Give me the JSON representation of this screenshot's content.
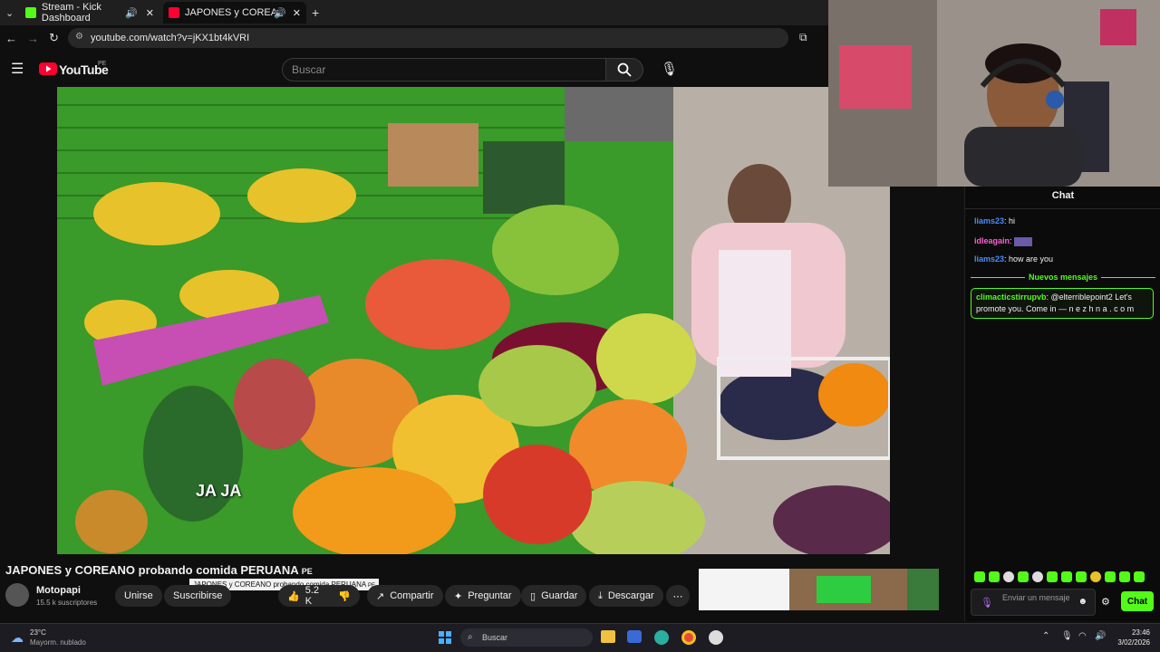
{
  "browser": {
    "tabs": [
      {
        "label": "Stream - Kick Dashboard"
      },
      {
        "label": "JAPONES y COREANO prob"
      }
    ],
    "url": "youtube.com/watch?v=jKX1bt4kVRI"
  },
  "youtube": {
    "logo_text": "YouTube",
    "region": "PE",
    "search_placeholder": "Buscar"
  },
  "video": {
    "caption": "JA JA",
    "title": "JAPONES y COREANO probando comida PERUANA",
    "title_flag": "PE",
    "tooltip": "JAPONES y COREANO probando comida PERUANA",
    "tooltip_flag": "PE"
  },
  "channel": {
    "name": "Motopapi",
    "subscribers": "15.5 k suscriptores",
    "join_label": "Unirse",
    "subscribe_label": "Suscribirse"
  },
  "actions": {
    "likes": "5.2 K",
    "share": "Compartir",
    "ask": "Preguntar",
    "save": "Guardar",
    "download": "Descargar"
  },
  "chat": {
    "header": "Chat",
    "messages": [
      {
        "user": "liams23",
        "text": ": hi"
      },
      {
        "user": "idleagain",
        "text": ":"
      },
      {
        "user": "liams23",
        "text": ": how are you"
      }
    ],
    "divider": "Nuevos mensajes",
    "highlight": {
      "user": "climacticstirrupvb",
      "text": ": @elterriblepoint2 Let's promote you. Come in — n e z h n a . c o m"
    },
    "input_placeholder": "Enviar un mensaje",
    "send_label": "Chat"
  },
  "taskbar": {
    "temp": "23°C",
    "weather": "Mayorm. nublado",
    "search_label": "Buscar",
    "time": "23:46",
    "date": "3/02/2026"
  },
  "colors": {
    "kick_green": "#53fc18",
    "youtube_red": "#ff0033",
    "chat_user_blue": "#4a8cf7",
    "chat_user_pink": "#ff5fd2"
  }
}
